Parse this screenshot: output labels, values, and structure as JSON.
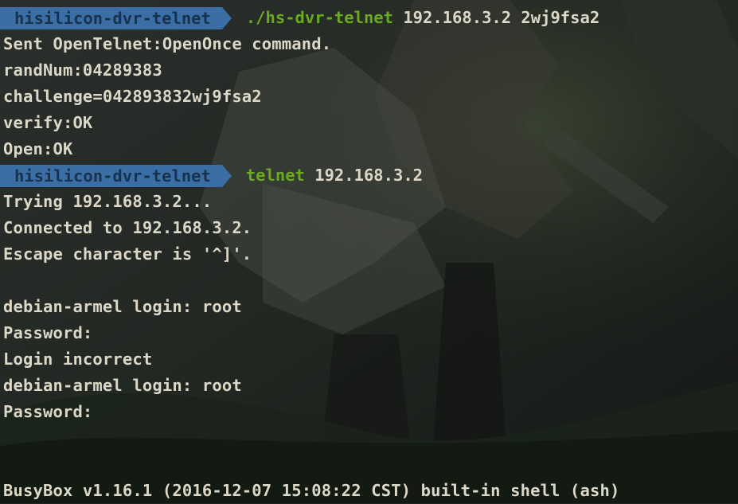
{
  "terminal": {
    "prompt_host": "hisilicon-dvr-telnet",
    "colors": {
      "background": "#1f2322",
      "text": "#dcd8c8",
      "prompt_bg": "#3a6ea5",
      "prompt_text": "#17324f",
      "command": "#6aaa1e"
    },
    "command1": {
      "name": "./hs-dvr-telnet",
      "args": "192.168.3.2 2wj9fsa2"
    },
    "output1": [
      "Sent OpenTelnet:OpenOnce command.",
      "randNum:04289383",
      "challenge=042893832wj9fsa2",
      "verify:OK",
      "Open:OK"
    ],
    "command2": {
      "name": "telnet",
      "args": "192.168.3.2"
    },
    "output2": [
      "Trying 192.168.3.2...",
      "Connected to 192.168.3.2.",
      "Escape character is '^]'.",
      "",
      "debian-armel login: root",
      "Password:",
      "Login incorrect",
      "debian-armel login: root",
      "Password:"
    ],
    "footer": "BusyBox v1.16.1 (2016-12-07 15:08:22 CST) built-in shell (ash)"
  }
}
